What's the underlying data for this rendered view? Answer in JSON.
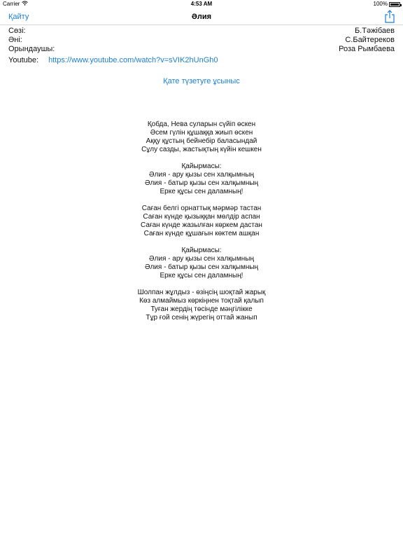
{
  "status": {
    "carrier": "Carrier",
    "time": "4:53 AM",
    "battery": "100%"
  },
  "nav": {
    "back_label": "Қайту",
    "title": "Әлия"
  },
  "meta": {
    "lyrics_label": "Сөзі:",
    "lyrics_value": "Б.Тәжібаев",
    "music_label": "Әні:",
    "music_value": "С.Байтереков",
    "performer_label": "Орындаушы:",
    "performer_value": "Роза Рымбаева",
    "youtube_label": "Youtube:",
    "youtube_url": "https://www.youtube.com/watch?v=sVIK2hUnGh0"
  },
  "suggest_label": "Қате түзетуге ұсыныс",
  "lyrics": [
    [
      "Қобда, Нева суларын сүйіп өскен",
      "Әсем гүлін құшаққа жиып өскен",
      "Аққу құстың бейнебір баласындай",
      "Сұлу сазды, жастықтың күйін кешкен"
    ],
    [
      "Қайырмасы:",
      "Әлия - ару қызы сен халқымның",
      "Әлия - батыр қызы сен халқымның",
      "Ерке құсы сен даламның!"
    ],
    [
      "Саған белгі орнаттық мәрмәр тастан",
      "Саған күнде қызыққан мөлдір аспан",
      "Саған күнде жазылған көркем дастан",
      "Саған күнде құшағын көктем ашқан"
    ],
    [
      "Қайырмасы:",
      "Әлия - ару қызы сен халқымның",
      "Әлия - батыр қызы сен халқымның",
      "Ерке құсы сен даламның!"
    ],
    [
      "Шолпан жұлдыз - өзіңсің шоқтай жарық",
      "Көз алмаймыз көркіңнен тоқтай қалып",
      "Туған жердің төсінде мәңгілікке",
      "Тұр ғой сенің жүрегің оттай жанып"
    ]
  ]
}
